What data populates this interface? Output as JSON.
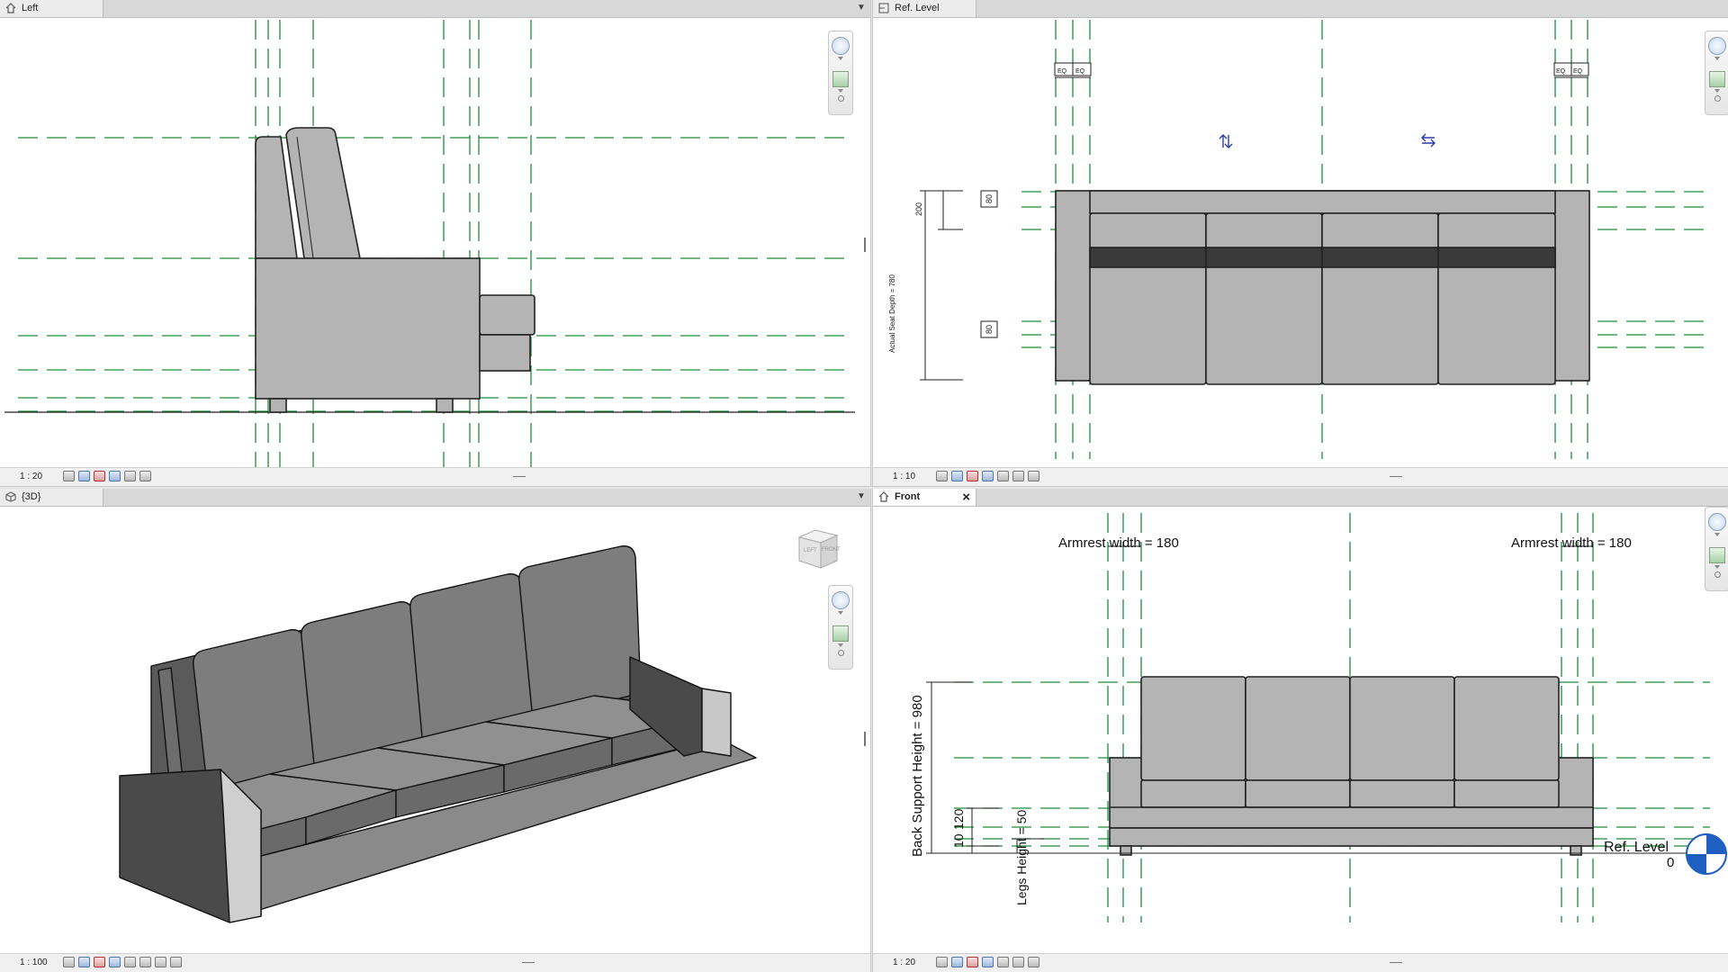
{
  "views": {
    "left": {
      "tab_label": "Left",
      "scale": "1 : 20"
    },
    "ref_level": {
      "tab_label": "Ref. Level",
      "scale": "1 : 10",
      "dimensions": {
        "eq": "EQ",
        "d200": "200",
        "d80": "80",
        "actual_seat_depth": "Actual Seat Depth = 780"
      }
    },
    "view3d": {
      "tab_label": "{3D}",
      "scale": "1 : 100",
      "viewcube": {
        "left_face": "LEFT",
        "front_face": "FRONT"
      }
    },
    "front": {
      "tab_label": "Front",
      "scale": "1 : 20",
      "dimensions": {
        "armrest_left": "Armrest width = 180",
        "armrest_right": "Armrest width = 180",
        "back_support": "Back Support Height = 980",
        "legs_height": "Legs Height = 50",
        "d10": "10",
        "d120": "120"
      },
      "level": {
        "name": "Ref. Level",
        "value": "0"
      }
    }
  },
  "colors": {
    "reference_plane": "#1e8c3a",
    "model_fill": "#b4b4b4",
    "model_dark": "#3a3a3a",
    "model_3d": "#7d7d7d",
    "level_head": "#1f5fbf",
    "tab_bar": "#d8d8d8"
  },
  "icons": {
    "view_tab": "house-icon",
    "cube_tab": "cube-icon",
    "close": "close-icon",
    "menu": "chevron-down-icon",
    "steering_wheel": "steering-wheel-icon",
    "zoom": "zoom-icon",
    "flip_up_down": "flip-vertical-icon",
    "flip_left_right": "flip-horizontal-icon"
  }
}
